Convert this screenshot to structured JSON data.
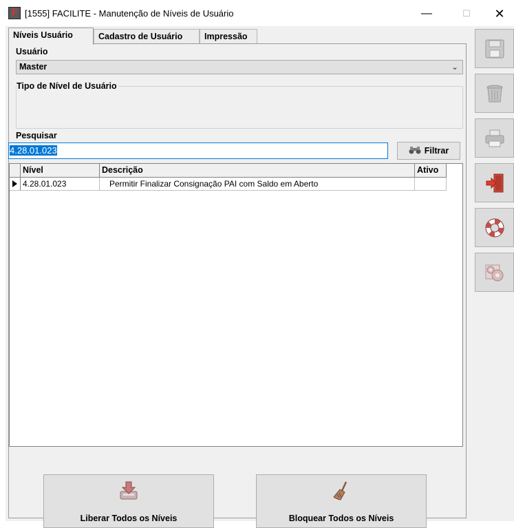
{
  "window": {
    "title": "[1555] FACILITE - Manutenção de Níveis de Usuário",
    "icon": "facilite-app-icon",
    "controls": {
      "minimize": "—",
      "maximize": "☐",
      "close": "✕"
    }
  },
  "tabs": [
    {
      "label": "Níveis Usuário",
      "active": true
    },
    {
      "label": "Cadastro de Usuário",
      "active": false
    },
    {
      "label": "Impressão",
      "active": false
    }
  ],
  "form": {
    "usuario_label": "Usuário",
    "usuario_value": "Master",
    "tipo_nivel_label": "Tipo de Nível de Usuário",
    "pesquisar_label": "Pesquisar",
    "pesquisar_value": "4.28.01.023",
    "filtrar_label": "Filtrar"
  },
  "grid": {
    "columns": [
      "Nível",
      "Descrição",
      "Ativo"
    ],
    "rows": [
      {
        "nivel": "4.28.01.023",
        "descricao": "Permitir Finalizar Consignação PAI com Saldo em Aberto",
        "ativo": ""
      }
    ]
  },
  "actions": {
    "liberar_label": "Liberar Todos os Níveis",
    "bloquear_label": "Bloquear Todos os Níveis"
  },
  "toolbar": [
    {
      "icon": "save-icon",
      "enabled": false
    },
    {
      "icon": "trash-icon",
      "enabled": false
    },
    {
      "icon": "printer-icon",
      "enabled": false
    },
    {
      "icon": "exit-door-icon",
      "enabled": true
    },
    {
      "icon": "help-lifebuoy-icon",
      "enabled": true
    },
    {
      "icon": "settings-gears-icon",
      "enabled": false
    }
  ],
  "colors": {
    "selection": "#0078d7",
    "exit_red": "#e53b2c",
    "lifebuoy_red": "#c0504d"
  }
}
